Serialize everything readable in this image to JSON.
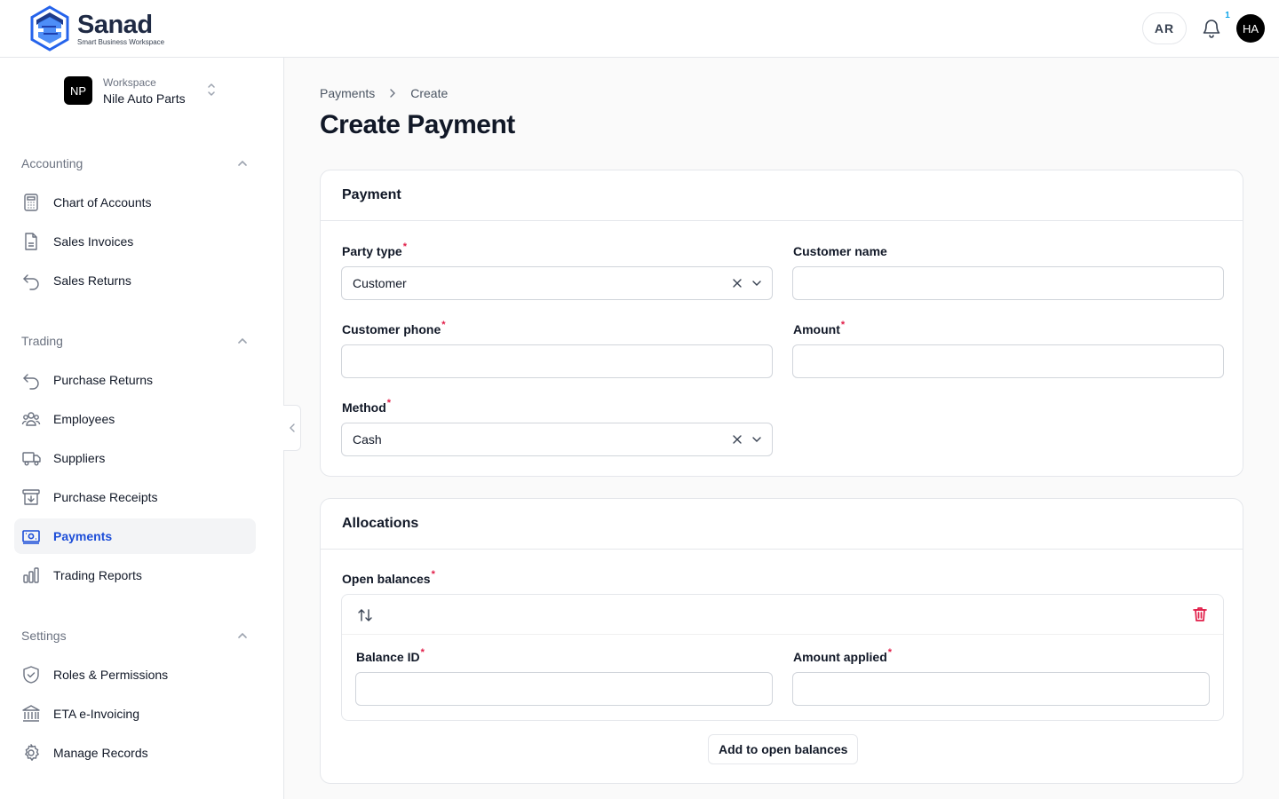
{
  "brand": {
    "name": "Sanad",
    "tagline": "Smart Business Workspace"
  },
  "header": {
    "language_button": "AR",
    "notification_count": "1",
    "user_initials": "HA"
  },
  "workspace": {
    "badge": "NP",
    "label": "Workspace",
    "name": "Nile Auto Parts"
  },
  "sidebar": {
    "sections": [
      {
        "label": "Accounting",
        "items": [
          {
            "label": "Chart of Accounts",
            "icon": "calculator-icon"
          },
          {
            "label": "Sales Invoices",
            "icon": "document-icon"
          },
          {
            "label": "Sales Returns",
            "icon": "return-arrow-icon"
          }
        ]
      },
      {
        "label": "Trading",
        "items": [
          {
            "label": "Purchase Returns",
            "icon": "return-arrow-icon"
          },
          {
            "label": "Employees",
            "icon": "users-icon"
          },
          {
            "label": "Suppliers",
            "icon": "truck-icon"
          },
          {
            "label": "Purchase Receipts",
            "icon": "archive-download-icon"
          },
          {
            "label": "Payments",
            "icon": "banknote-icon",
            "active": true
          },
          {
            "label": "Trading Reports",
            "icon": "bar-chart-icon"
          }
        ]
      },
      {
        "label": "Settings",
        "items": [
          {
            "label": "Roles & Permissions",
            "icon": "shield-check-icon"
          },
          {
            "label": "ETA e-Invoicing",
            "icon": "bank-building-icon"
          },
          {
            "label": "Manage Records",
            "icon": "gear-icon"
          }
        ]
      }
    ]
  },
  "breadcrumb": {
    "parent": "Payments",
    "current": "Create"
  },
  "page": {
    "title": "Create Payment"
  },
  "payment_card": {
    "title": "Payment",
    "party_type": {
      "label": "Party type",
      "value": "Customer"
    },
    "customer_name": {
      "label": "Customer name",
      "value": ""
    },
    "customer_phone": {
      "label": "Customer phone",
      "value": ""
    },
    "amount": {
      "label": "Amount",
      "value": ""
    },
    "method": {
      "label": "Method",
      "value": "Cash"
    }
  },
  "allocations_card": {
    "title": "Allocations",
    "open_balances_label": "Open balances",
    "balance_id": {
      "label": "Balance ID",
      "value": ""
    },
    "amount_applied": {
      "label": "Amount applied",
      "value": ""
    },
    "add_button": "Add to open balances"
  },
  "colors": {
    "accent": "#1d4ed8",
    "required": "#e11d48",
    "danger": "#e11d48",
    "badge": "#0ea5e9"
  }
}
